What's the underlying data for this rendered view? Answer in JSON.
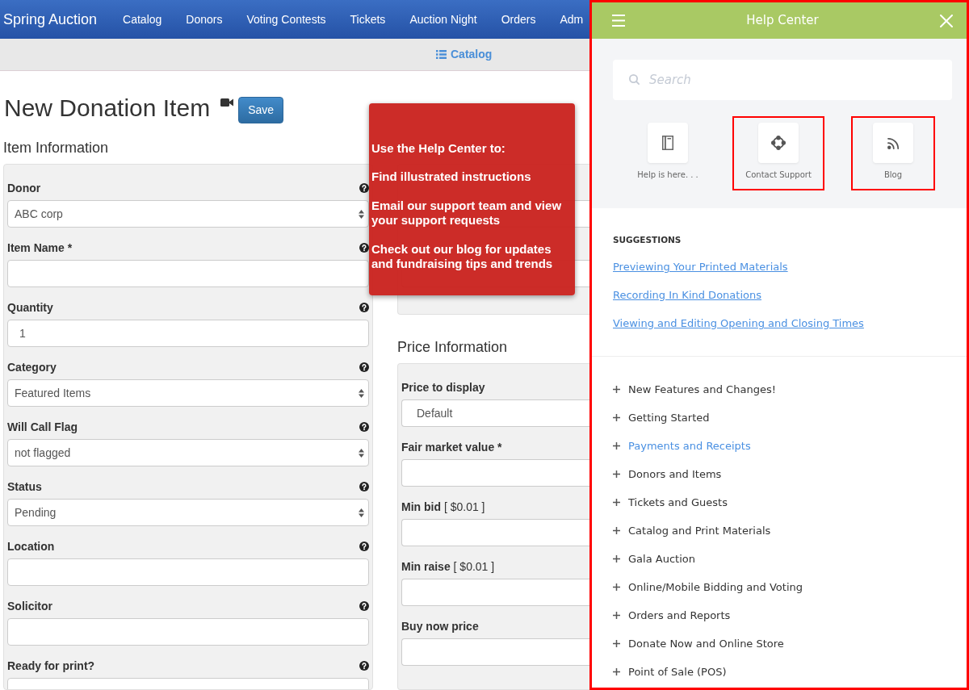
{
  "navbar": {
    "brand": "Spring Auction",
    "items": [
      "Catalog",
      "Donors",
      "Voting Contests",
      "Tickets",
      "Auction Night",
      "Orders",
      "Adm"
    ]
  },
  "subnav": {
    "link": "Catalog"
  },
  "page_header": {
    "title": "New Donation Item",
    "save_button": "Save"
  },
  "item_information": {
    "heading": "Item Information",
    "fields": [
      {
        "label": "Donor",
        "kind": "select",
        "value": "ABC corp",
        "help": true
      },
      {
        "label": "Item Name *",
        "kind": "input",
        "help": true
      },
      {
        "label": "Quantity",
        "kind": "input",
        "value": "1",
        "help": true
      },
      {
        "label": "Category",
        "kind": "select",
        "value": "Featured Items",
        "help": true
      },
      {
        "label": "Will Call Flag",
        "kind": "select",
        "value": "not flagged",
        "help": true
      },
      {
        "label": "Status",
        "kind": "select",
        "value": "Pending",
        "help": true
      },
      {
        "label": "Location",
        "kind": "input",
        "help": true
      },
      {
        "label": "Solicitor",
        "kind": "input",
        "help": true
      },
      {
        "label": "Ready for print?",
        "kind": "select",
        "help": true
      }
    ]
  },
  "bidding": {
    "fields": [
      {
        "kind": "select"
      },
      {
        "kind": "select"
      }
    ]
  },
  "price_information": {
    "heading": "Price Information",
    "fields": [
      {
        "label": "Price to display",
        "kind": "select",
        "value": "Default"
      },
      {
        "label": "Fair market value *",
        "kind": "input"
      },
      {
        "label": "Min bid",
        "hint": "[ $0.01 ]",
        "kind": "input"
      },
      {
        "label": "Min raise",
        "hint": "[ $0.01 ]",
        "kind": "input"
      },
      {
        "label": "Buy now price",
        "kind": "input"
      }
    ]
  },
  "tooltip": {
    "heading": "Use the Help Center to:",
    "lines": [
      "Find illustrated instructions",
      "Email our support team and view your support requests",
      "Check out our blog for updates and fundraising tips and trends"
    ]
  },
  "help_center": {
    "title": "Help Center",
    "outlined": true,
    "search": {
      "placeholder": "Search"
    },
    "tiles": [
      {
        "label": "Help is here. . .",
        "outlined": false
      },
      {
        "label": "Contact Support",
        "outlined": true
      },
      {
        "label": "Blog",
        "outlined": true
      }
    ],
    "suggestions": {
      "heading": "SUGGESTIONS",
      "links": [
        "Previewing Your Printed Materials",
        "Recording In Kind Donations",
        "Viewing and Editing Opening and Closing Times"
      ]
    },
    "categories": [
      {
        "label": "New Features and Changes!",
        "expanded": false,
        "highlighted": false
      },
      {
        "label": "Getting Started",
        "expanded": false,
        "highlighted": false
      },
      {
        "label": "Payments and Receipts",
        "expanded": false,
        "highlighted": true
      },
      {
        "label": "Donors and Items",
        "expanded": false,
        "highlighted": false
      },
      {
        "label": "Tickets and Guests",
        "expanded": false,
        "highlighted": false
      },
      {
        "label": "Catalog and Print Materials",
        "expanded": false,
        "highlighted": false
      },
      {
        "label": "Gala Auction",
        "expanded": false,
        "highlighted": false
      },
      {
        "label": "Online/Mobile Bidding and Voting",
        "expanded": false,
        "highlighted": false
      },
      {
        "label": "Orders and Reports",
        "expanded": false,
        "highlighted": false
      },
      {
        "label": "Donate Now and Online Store",
        "expanded": false,
        "highlighted": false
      },
      {
        "label": "Point of Sale (POS)",
        "expanded": false,
        "highlighted": false
      }
    ]
  }
}
